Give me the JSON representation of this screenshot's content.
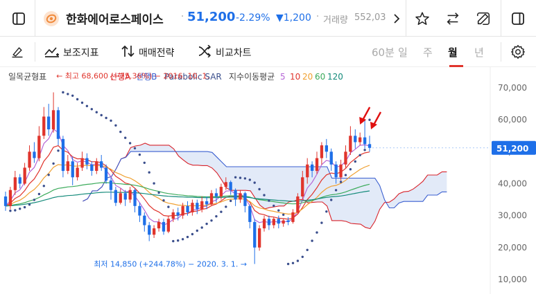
{
  "header": {
    "stock_name": "한화에어로스페이스",
    "price": "51,200",
    "change_pct": "-2.29%",
    "change_amt": "▼1,200",
    "volume_label": "거래량",
    "volume_value": "552,03"
  },
  "toolbar": {
    "indicator_label": "보조지표",
    "strategy_label": "매매전략",
    "compare_label": "비교차트",
    "periods": [
      "60분",
      "일",
      "주",
      "월",
      "년"
    ],
    "active_period": "월"
  },
  "chart_data": {
    "type": "candlestick",
    "yaxis_ticks": [
      70000,
      60000,
      50000,
      40000,
      30000,
      20000,
      10000
    ],
    "yaxis_tick_labels": [
      "70,000",
      "60,000",
      "50,000",
      "40,000",
      "30,000",
      "20,000",
      "10,000"
    ],
    "ylim": [
      8000,
      75000
    ],
    "current_price": 51200,
    "current_price_label": "51,200",
    "colors": {
      "up": "#e0342c",
      "down": "#1e6fe8",
      "ma5": "#b566d6",
      "ma10": "#e0342c",
      "ma20": "#f0a030",
      "ma60": "#3aaa5a",
      "ma120": "#138a7a",
      "cloud_line_a": "#d8222a",
      "cloud_line_b": "#3a5fd0",
      "cloud_fill": "#dde6f7",
      "sar": "#3a4e8c",
      "annotation_high": "#e0342c",
      "annotation_low": "#1e6fe8"
    },
    "legend": {
      "ichimoku_label": "일목균형표",
      "span_a_label": "선행A",
      "span_b_label": "선행B",
      "sar_label": "Parabolic SAR",
      "ma_label": "지수이동평균",
      "ma_periods": [
        "5",
        "10",
        "20",
        "60",
        "120"
      ]
    },
    "annotations": {
      "high": "최고 68,600 (−25.36%) − 2016. 10. 1.",
      "low": "최저 14,850 (+244.78%) − 2020. 3. 1."
    },
    "candles": [
      [
        36000,
        33000,
        37500,
        31500
      ],
      [
        33000,
        38000,
        39000,
        32000
      ],
      [
        38000,
        42000,
        44000,
        36500
      ],
      [
        42000,
        40000,
        43000,
        38500
      ],
      [
        40000,
        45000,
        46500,
        39500
      ],
      [
        45000,
        50000,
        52000,
        44000
      ],
      [
        50000,
        48000,
        53000,
        46500
      ],
      [
        48000,
        55000,
        58000,
        47000
      ],
      [
        55000,
        61000,
        64000,
        54000
      ],
      [
        61000,
        57000,
        65000,
        55000
      ],
      [
        57000,
        63000,
        68600,
        56000
      ],
      [
        63000,
        54000,
        64000,
        52000
      ],
      [
        54000,
        44000,
        55000,
        42000
      ],
      [
        44000,
        47000,
        49000,
        43000
      ],
      [
        47000,
        42000,
        48500,
        39500
      ],
      [
        42000,
        45000,
        46500,
        41000
      ],
      [
        45000,
        48000,
        50000,
        44000
      ],
      [
        48000,
        46000,
        49500,
        44500
      ],
      [
        46000,
        44000,
        47000,
        42500
      ],
      [
        44000,
        47000,
        48000,
        43000
      ],
      [
        47000,
        45000,
        49000,
        44000
      ],
      [
        45000,
        41000,
        46000,
        40000
      ],
      [
        41000,
        38000,
        42000,
        35000
      ],
      [
        38000,
        34000,
        39000,
        33000
      ],
      [
        34000,
        37000,
        38500,
        33500
      ],
      [
        37000,
        35000,
        38000,
        33000
      ],
      [
        35000,
        38000,
        39000,
        34000
      ],
      [
        38000,
        33000,
        38500,
        31000
      ],
      [
        33000,
        30000,
        34000,
        28000
      ],
      [
        30000,
        27000,
        31000,
        25000
      ],
      [
        27000,
        24000,
        28000,
        22000
      ],
      [
        24000,
        26000,
        27000,
        23000
      ],
      [
        26000,
        28000,
        29000,
        25000
      ],
      [
        28000,
        25000,
        29000,
        24000
      ],
      [
        25000,
        29000,
        30000,
        24500
      ],
      [
        29000,
        31000,
        32000,
        28000
      ],
      [
        31000,
        30000,
        32500,
        28500
      ],
      [
        30000,
        33000,
        34000,
        29000
      ],
      [
        33000,
        31000,
        34500,
        30000
      ],
      [
        31000,
        34000,
        35000,
        30000
      ],
      [
        34000,
        32000,
        35000,
        30500
      ],
      [
        32000,
        34500,
        36000,
        31000
      ],
      [
        34500,
        33500,
        36000,
        32000
      ],
      [
        33500,
        37000,
        38000,
        33000
      ],
      [
        37000,
        36000,
        38500,
        34000
      ],
      [
        36000,
        39000,
        40000,
        35000
      ],
      [
        39000,
        40500,
        42000,
        38000
      ],
      [
        40500,
        38000,
        41000,
        36500
      ],
      [
        38000,
        35000,
        38500,
        33000
      ],
      [
        35000,
        37000,
        38000,
        34000
      ],
      [
        37000,
        33000,
        37500,
        31000
      ],
      [
        33000,
        28000,
        33500,
        26000
      ],
      [
        28000,
        20000,
        29000,
        14850
      ],
      [
        20000,
        26000,
        27000,
        19000
      ],
      [
        26000,
        29000,
        30000,
        25000
      ],
      [
        29000,
        27000,
        30000,
        25500
      ],
      [
        27000,
        29000,
        29500,
        26000
      ],
      [
        29000,
        27500,
        30000,
        26000
      ],
      [
        27500,
        28500,
        29000,
        26500
      ],
      [
        28500,
        28000,
        29500,
        27000
      ],
      [
        28000,
        31000,
        32000,
        27500
      ],
      [
        31000,
        36000,
        37000,
        30500
      ],
      [
        36000,
        42000,
        44000,
        35000
      ],
      [
        42000,
        46000,
        48000,
        40000
      ],
      [
        46000,
        44000,
        47000,
        42000
      ],
      [
        44000,
        48000,
        50000,
        43000
      ],
      [
        48000,
        52000,
        53000,
        46000
      ],
      [
        52000,
        50000,
        54000,
        48000
      ],
      [
        50000,
        46000,
        51000,
        44000
      ],
      [
        46000,
        42000,
        47000,
        40000
      ],
      [
        42000,
        46000,
        47500,
        41000
      ],
      [
        46000,
        50000,
        52000,
        45000
      ],
      [
        50000,
        55000,
        58000,
        49000
      ],
      [
        55000,
        53000,
        57000,
        51000
      ],
      [
        53000,
        54500,
        56000,
        52000
      ],
      [
        54500,
        52400,
        60000,
        51000
      ],
      [
        52400,
        51200,
        55000,
        50000
      ]
    ]
  }
}
